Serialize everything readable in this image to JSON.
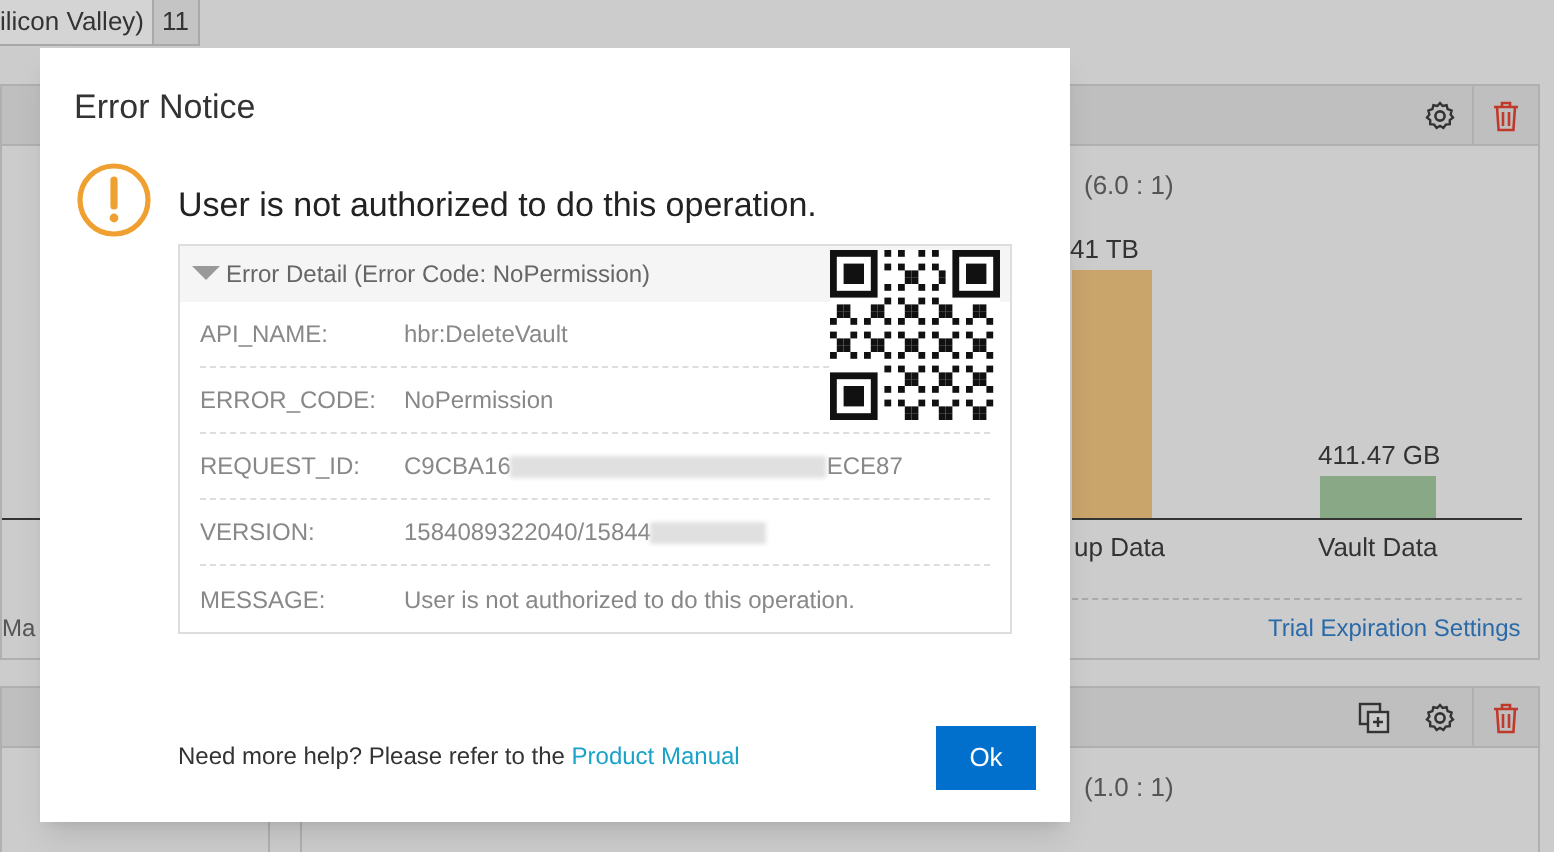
{
  "background": {
    "tabs": [
      {
        "label": "ilicon Valley)",
        "selected": true
      },
      {
        "label": "11",
        "selected": false
      }
    ],
    "panels": [
      {
        "ratio": "(6.0 : 1)",
        "bars": [
          {
            "label": "41 TB",
            "category": "up Data",
            "color": "#c9a46b"
          },
          {
            "label": "411.47 GB",
            "category": "Vault Data",
            "color": "#88a886"
          }
        ],
        "left_text": "Ma",
        "link": "Trial Expiration Settings",
        "tools": [
          {
            "kind": "settings"
          },
          {
            "kind": "delete"
          }
        ]
      },
      {
        "ratio": "(1.0 : 1)",
        "tools": [
          {
            "kind": "copy"
          },
          {
            "kind": "settings"
          },
          {
            "kind": "delete"
          }
        ]
      }
    ]
  },
  "dialog": {
    "title": "Error Notice",
    "message": "User is not authorized to do this operation.",
    "detail": {
      "heading": "Error Detail (Error Code: NoPermission)",
      "expanded": true,
      "rows": [
        {
          "label": "API_NAME:",
          "value": "hbr:DeleteVault"
        },
        {
          "label": "ERROR_CODE:",
          "value": "NoPermission"
        },
        {
          "label": "REQUEST_ID:",
          "value": "C9CBA16",
          "redacted": true,
          "value_end": "ECE87"
        },
        {
          "label": "VERSION:",
          "value": "1584089322040/15844",
          "redacted": true
        },
        {
          "label": "MESSAGE:",
          "value": "User is not authorized to do this operation."
        }
      ]
    },
    "help_text": "Need more help? Please refer to the",
    "help_link": "Product Manual",
    "button": "Ok"
  }
}
